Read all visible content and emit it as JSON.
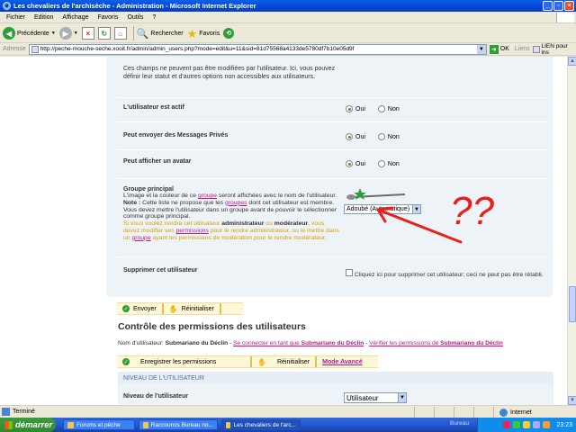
{
  "window": {
    "title": "Les chevaliers de l'archisèche - Administration - Microsoft Internet Explorer"
  },
  "menu": [
    "Fichier",
    "Edition",
    "Affichage",
    "Favoris",
    "Outils",
    "?"
  ],
  "toolbar": {
    "back_label": "Précédente",
    "search_label": "Rechercher",
    "favorites_label": "Favoris"
  },
  "address": {
    "label": "Adresse",
    "url": "http://peche-mouche-seche.xooit.fr/admin/admin_users.php?mode=edit&u=11&sid=81d75568a4133de5780df7b10e05d9f",
    "go_label": "OK",
    "links_label": "Liens",
    "link_item": "LIEN pour ins"
  },
  "form": {
    "intro": "Ces champs ne peuvent pas être modifiées par l'utilisateur. Ici, vous pouvez définir leur statut et d'autres options non accessibles aux utilisateurs.",
    "active_label": "L'utilisateur est actif",
    "pm_label": "Peut envoyer des Messages Privés",
    "avatar_label": "Peut afficher un avatar",
    "yes": "Oui",
    "no": "Non",
    "group": {
      "title": "Groupe principal",
      "line1_a": "L'image et la couleur de ce ",
      "line1_link": "groupe",
      "line1_b": " seront affichées avec le nom de l'utilisateur.",
      "note_label": "Note :",
      "note_a": " Cette liste ne propose que les ",
      "note_link": "groupes",
      "note_b": " dont cet utilisateur est membre. Vous devez mettre l'utilisateur dans un groupe avant de pouvoir le sélectionner comme groupe principal.",
      "warn_a": "Si vous voulez rendre cet utilisateur ",
      "warn_admin": "administrateur",
      "warn_or": " ou ",
      "warn_mod": "modérateur",
      "warn_b": ", vous devez modifier ses ",
      "warn_link1": "permissions",
      "warn_c": " pour le rendre administrateur, ou le mettre dans un ",
      "warn_link2": "groupe",
      "warn_d": " ayant les permissions de modération pour le rendre modérateur.",
      "select_value": "Adoubé (Automatique)"
    },
    "delete_label": "Supprimer cet utilisateur",
    "delete_text": "Cliquez ici pour supprimer cet utilisateur; ceci ne peut pas être rétabli."
  },
  "buttons": {
    "send": "Envoyer",
    "reset": "Réinitialiser",
    "save_perms": "Enregistrer les permissions",
    "reset2": "Réinitialiser",
    "advanced": "Mode Avancé"
  },
  "perms": {
    "heading": "Contrôle des permissions des utilisateurs",
    "user_prefix": "Nom d'utilisateur: ",
    "username": "Submariano du Déclin",
    "dash": " - ",
    "login_as_link": "Se connecter en tant que ",
    "verify_link": "Vérifier les permissions de ",
    "level_head": "NIVEAU DE L'UTILISATEUR",
    "level_label": "Niveau de l'utilisateur",
    "level_value": "Utilisateur"
  },
  "annotation": {
    "text": "??",
    "color": "#e8201a"
  },
  "status": {
    "text": "Terminé",
    "zone": "Internet"
  },
  "taskbar": {
    "start": "démarrer",
    "tasks": [
      "Forums et pêche",
      "Raccourcis Bureau no...",
      "Les chevaliers de l'arc..."
    ],
    "bureau": "Bureau",
    "clock": "23:23"
  }
}
